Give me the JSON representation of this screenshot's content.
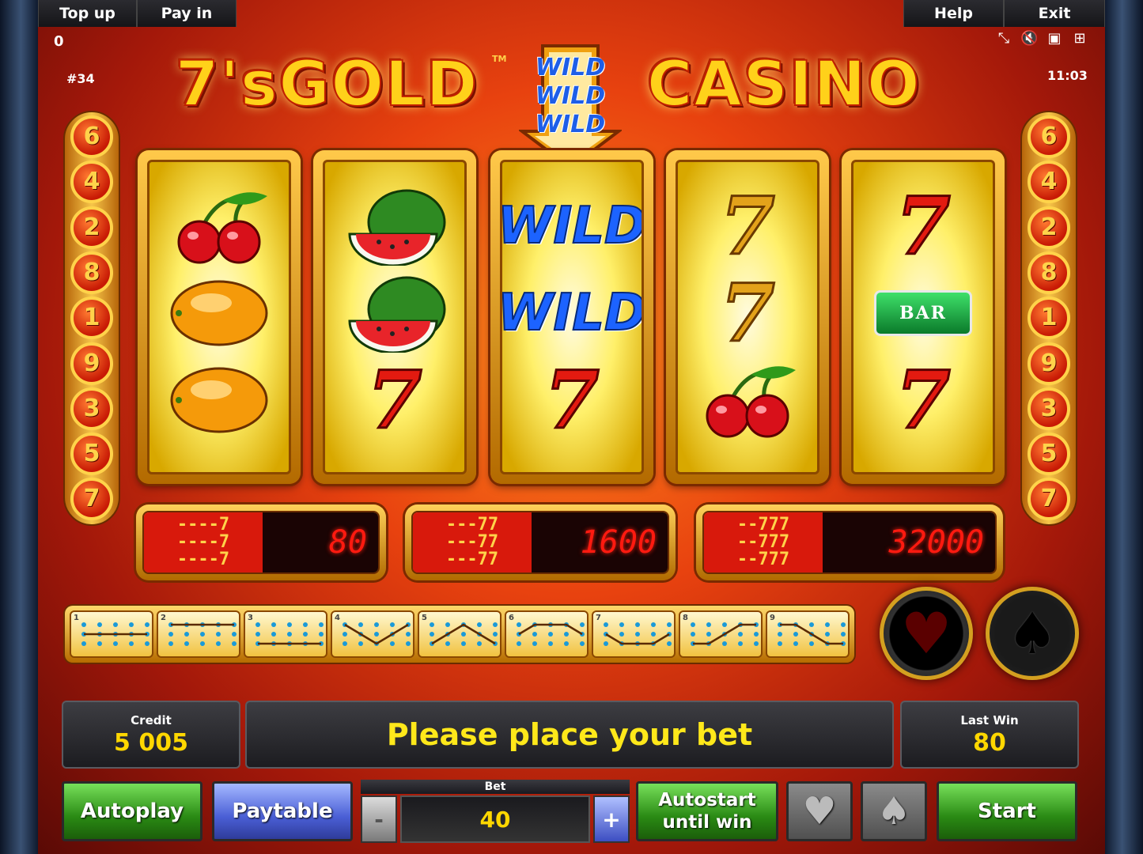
{
  "topbar": {
    "top_up": "Top up",
    "pay_in": "Pay in",
    "help": "Help",
    "exit": "Exit",
    "balance_small": "0",
    "game_id": "#34",
    "clock": "11:03"
  },
  "logo": {
    "left": "7'sGOLD",
    "right": "CASINO",
    "trademark": "TM",
    "wild_words": [
      "WILD",
      "WILD",
      "WILD"
    ]
  },
  "line_numbers": [
    "6",
    "4",
    "2",
    "8",
    "1",
    "9",
    "3",
    "5",
    "7"
  ],
  "reels": [
    [
      "cherry",
      "orange",
      "orange"
    ],
    [
      "watermelon",
      "watermelon",
      "red-seven"
    ],
    [
      "wild",
      "wild",
      "red-seven"
    ],
    [
      "gold-seven",
      "gold-seven",
      "cherry"
    ],
    [
      "red-seven",
      "bar",
      "red-seven"
    ]
  ],
  "symbols": {
    "wild": "WILD",
    "seven": "7",
    "bar": "BAR"
  },
  "paytable": [
    {
      "pattern": "----7\n----7\n----7",
      "value": "80"
    },
    {
      "pattern": "---77\n---77\n---77",
      "value": "1600"
    },
    {
      "pattern": "--777\n--777\n--777",
      "value": "32000"
    }
  ],
  "line_buttons": [
    "1",
    "2",
    "3",
    "4",
    "5",
    "6",
    "7",
    "8",
    "9"
  ],
  "info": {
    "credit_label": "Credit",
    "credit_value": "5 005",
    "message": "Please place your bet",
    "last_win_label": "Last Win",
    "last_win_value": "80"
  },
  "controls": {
    "autoplay": "Autoplay",
    "paytable": "Paytable",
    "bet_label": "Bet",
    "bet_value": "40",
    "bet_minus": "-",
    "bet_plus": "+",
    "autostart_line1": "Autostart",
    "autostart_line2": "until win",
    "start": "Start"
  },
  "colors": {
    "accent_gold": "#ffd700",
    "message_yellow": "#ffe81a",
    "start_green": "#2a8a14",
    "paytable_blue": "#4a5fd6"
  }
}
